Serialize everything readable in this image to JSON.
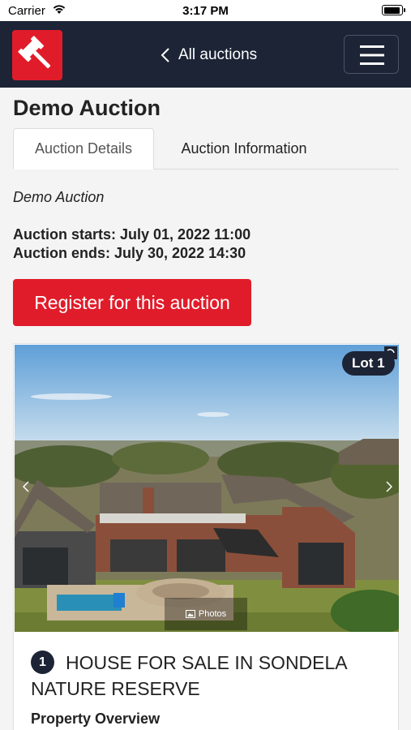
{
  "status_bar": {
    "carrier": "Carrier",
    "time": "3:17 PM",
    "battery_level": 0.95
  },
  "header": {
    "logo_icon": "gavel-icon",
    "back_label": "All auctions",
    "menu_icon": "hamburger-icon",
    "background_color": "#1c2436",
    "accent_color": "#e11c2a"
  },
  "page": {
    "title": "Demo Auction",
    "tabs": [
      {
        "label": "Auction Details",
        "active": true
      },
      {
        "label": "Auction Information",
        "active": false
      }
    ],
    "auction_name": "Demo Auction",
    "starts": "Auction starts: July 01, 2022 11:00",
    "ends": "Auction ends: July 30, 2022 14:30",
    "register_label": "Register for this auction"
  },
  "lot": {
    "badge": "Lot 1",
    "number": "1",
    "title": "HOUSE FOR SALE IN SONDELA NATURE RESERVE",
    "subtitle": "Property Overview",
    "photos_label": "Photos",
    "prev_icon": "chevron-left-icon",
    "next_icon": "chevron-right-icon"
  }
}
